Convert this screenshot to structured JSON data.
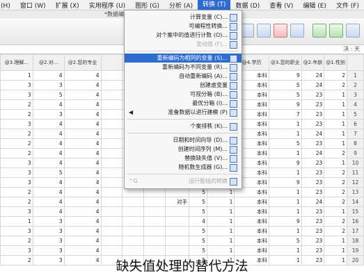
{
  "menubar": {
    "items": [
      "文件 (F)",
      "编辑 (E)",
      "查看 (V)",
      "数据 (D)",
      "转换 (T)",
      "分析 (A)",
      "图形 (G)",
      "实用程序 (U)",
      "扩展 (X)",
      "窗口 (W)",
      "帮助 (H)"
    ],
    "active_index": 4
  },
  "window_title": "*数据编辑器 IBM SPSS Statistics 数据编辑器",
  "formula_bar": {
    "value": "决 : 天"
  },
  "table": {
    "headers": [
      "",
      "@1.性别",
      "@2.年龄",
      "@3.您的职业",
      "@4.学历",
      "@5.你的...",
      "",
      "",
      "",
      "",
      "",
      "@2.您的专业",
      "@2.对...",
      "@3.理解..."
    ],
    "rows": [
      [
        "1",
        "2",
        "24",
        "9",
        "本科",
        "1",
        "5",
        "",
        "",
        "",
        "",
        "4",
        "4",
        "1"
      ],
      [
        "2",
        "2",
        "24",
        "5",
        "本科",
        "1",
        "5",
        "",
        "",
        "",
        "",
        "4",
        "3",
        "3"
      ],
      [
        "3",
        "1",
        "23",
        "5",
        "本科",
        "1",
        "4",
        "",
        "",
        "",
        "",
        "4",
        "5",
        "3"
      ],
      [
        "4",
        "1",
        "23",
        "9",
        "本科",
        "1",
        "4",
        "",
        "",
        "",
        "",
        "4",
        "4",
        "2"
      ],
      [
        "5",
        "1",
        "23",
        "7",
        "本科",
        "1",
        "4",
        "",
        "",
        "",
        "",
        "4",
        "3",
        "2"
      ],
      [
        "6",
        "1",
        "23",
        "1",
        "本科",
        "1",
        "5",
        "",
        "",
        "",
        "",
        "4",
        "4",
        "3"
      ],
      [
        "7",
        "1",
        "24",
        "1",
        "本科",
        "1",
        "5",
        "",
        "",
        "",
        "",
        "4",
        "4",
        "2"
      ],
      [
        "8",
        "1",
        "23",
        "5",
        "本科",
        "1",
        "5",
        "",
        "",
        "",
        "",
        "4",
        "4",
        "2"
      ],
      [
        "9",
        "2",
        "24",
        "1",
        "本科",
        "1",
        "5",
        "",
        "",
        "",
        "",
        "4",
        "4",
        "2"
      ],
      [
        "10",
        "1",
        "23",
        "9",
        "本科",
        "1",
        "5",
        "",
        "",
        "",
        "",
        "4",
        "4",
        "3"
      ],
      [
        "11",
        "2",
        "23",
        "1",
        "本科",
        "1",
        "4",
        "",
        "",
        "",
        "",
        "4",
        "5",
        "3"
      ],
      [
        "12",
        "2",
        "23",
        "9",
        "本科",
        "1",
        "5",
        "",
        "",
        "",
        "",
        "4",
        "4",
        "3"
      ],
      [
        "13",
        "2",
        "23",
        "1",
        "本科",
        "1",
        "5",
        "",
        "",
        "",
        "",
        "4",
        "4",
        "2"
      ],
      [
        "14",
        "2",
        "24",
        "1",
        "本科",
        "1",
        "5",
        "对手",
        "",
        "",
        "",
        "4",
        "4",
        "2"
      ],
      [
        "15",
        "1",
        "23",
        "1",
        "本科",
        "1",
        "5",
        "",
        "",
        "",
        "",
        "4",
        "4",
        "3"
      ],
      [
        "16",
        "2",
        "23",
        "9",
        "本科",
        "1",
        "4",
        "",
        "",
        "",
        "",
        "4",
        "3",
        "1"
      ],
      [
        "17",
        "2",
        "23",
        "1",
        "本科",
        "1",
        "5",
        "",
        "",
        "",
        "",
        "4",
        "3",
        "3"
      ],
      [
        "18",
        "1",
        "23",
        "5",
        "本科",
        "1",
        "5",
        "",
        "",
        "",
        "",
        "4",
        "3",
        "2"
      ],
      [
        "19",
        "1",
        "23",
        "1",
        "本科",
        "1",
        "5",
        "",
        "",
        "",
        "",
        "4",
        "3",
        "3"
      ],
      [
        "20",
        "1",
        "23",
        "1",
        "本科",
        "1",
        "5",
        "",
        "",
        "",
        "",
        "4",
        "3",
        "2"
      ]
    ]
  },
  "menu": {
    "items": [
      {
        "label": "计算变量 (C)...",
        "type": "item"
      },
      {
        "label": "可编程性转换...",
        "type": "item"
      },
      {
        "label": "对个案中的值进行计数 (O)...",
        "type": "item"
      },
      {
        "label": "变动值 (F)...",
        "type": "disabled"
      },
      {
        "label": "",
        "type": "sep"
      },
      {
        "label": "重新编码为相同的变量 (S)...",
        "type": "highlight"
      },
      {
        "label": "重新编码为不同变量 (R)...",
        "type": "item"
      },
      {
        "label": "自动重新编码 (A)...",
        "type": "item"
      },
      {
        "label": "创建虚变量",
        "type": "item"
      },
      {
        "label": "可视分箱 (B)...",
        "type": "item"
      },
      {
        "label": "最优分箱 (I)...",
        "type": "item"
      },
      {
        "label": "准备数据以进行建模 (P)",
        "type": "submenu"
      },
      {
        "label": "",
        "type": "sep"
      },
      {
        "label": "个案排秩 (K)...",
        "type": "item"
      },
      {
        "label": "",
        "type": "sep"
      },
      {
        "label": "日期和时间向导 (D)...",
        "type": "item"
      },
      {
        "label": "创建时间序列 (M)...",
        "type": "item"
      },
      {
        "label": "替换缺失值 (V)...",
        "type": "item"
      },
      {
        "label": "随机数生成器 (G)...",
        "type": "item"
      },
      {
        "label": "",
        "type": "sep"
      },
      {
        "label": "运行暂挂的转换",
        "type": "disabled"
      }
    ],
    "shortcut": "^G"
  },
  "caption": "缺失值处理的替代方法"
}
